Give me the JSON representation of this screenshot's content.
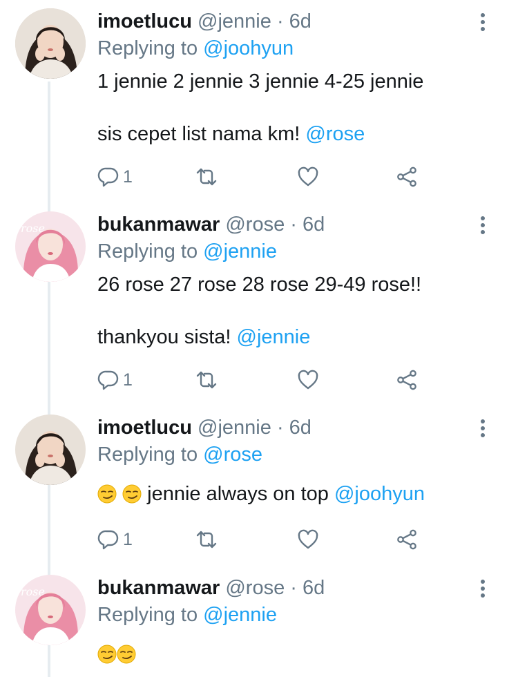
{
  "colors": {
    "link": "#1da1f2",
    "muted": "#657786",
    "text": "#14171a",
    "thread_line": "#e6ecf0"
  },
  "tweets": [
    {
      "name": "imoetlucu",
      "handle": "@jennie",
      "dot": "·",
      "time": "6d",
      "replying_label": "Replying to",
      "replying_to": "@joohyun",
      "line1": "1 jennie 2 jennie 3 jennie 4-25 jennie",
      "line2_text": "sis cepet list nama km!",
      "line2_mention": "@rose",
      "reply_count": "1",
      "avatar": "jennie-avatar"
    },
    {
      "name": "bukanmawar",
      "handle": "@rose",
      "dot": "·",
      "time": "6d",
      "replying_label": "Replying to",
      "replying_to": "@jennie",
      "line1": "26 rose 27 rose 28 rose 29-49 rose!!",
      "line2_text": "thankyou sista!",
      "line2_mention": "@jennie",
      "reply_count": "1",
      "avatar": "rose-avatar"
    },
    {
      "name": "imoetlucu",
      "handle": "@jennie",
      "dot": "·",
      "time": "6d",
      "replying_label": "Replying to",
      "replying_to": "@rose",
      "line1_text": "jennie always on top",
      "line1_mention": "@joohyun",
      "line1_emoji": [
        "smirking-face",
        "smirking-face"
      ],
      "reply_count": "1",
      "avatar": "jennie-avatar"
    },
    {
      "name": "bukanmawar",
      "handle": "@rose",
      "dot": "·",
      "time": "6d",
      "replying_label": "Replying to",
      "replying_to": "@jennie",
      "line1_emoji": [
        "smirking-face",
        "smirking-face"
      ],
      "avatar": "rose-avatar"
    }
  ],
  "icons": {
    "reply": "reply-icon",
    "retweet": "retweet-icon",
    "like": "heart-icon",
    "share": "share-icon",
    "more": "more-vertical-icon"
  }
}
